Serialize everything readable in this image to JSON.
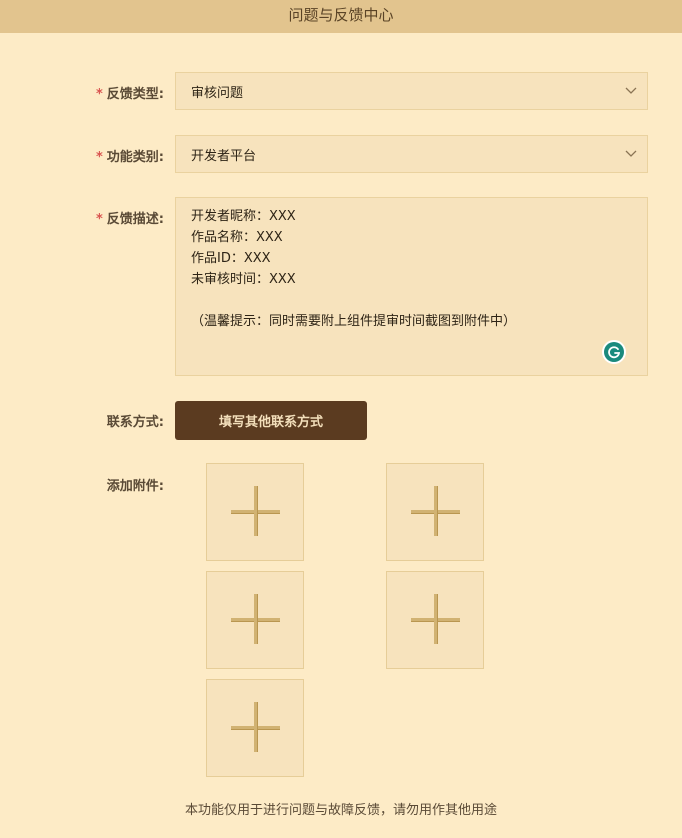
{
  "header": {
    "title": "问题与反馈中心"
  },
  "form": {
    "required_mark": "*",
    "feedback_type": {
      "label": "反馈类型:",
      "value": "审核问题"
    },
    "feature_category": {
      "label": "功能类别:",
      "value": "开发者平台"
    },
    "description": {
      "label": "反馈描述:",
      "lines": [
        "开发者昵称：XXX",
        "作品名称：XXX",
        "作品ID：XXX",
        "未审核时间：XXX",
        "",
        "（温馨提示：同时需要附上组件提审时间截图到附件中）"
      ]
    },
    "contact": {
      "label": "联系方式:",
      "button_label": "填写其他联系方式"
    },
    "attachments": {
      "label": "添加附件:",
      "slot_count": 5
    }
  },
  "footer": {
    "note": "本功能仅用于进行问题与故障反馈，请勿用作其他用途"
  },
  "icons": {
    "dropdown": "chevron-down-icon",
    "grammar": "grammarly-icon",
    "add": "plus-icon"
  },
  "colors": {
    "background": "#fdebc6",
    "header": "#e2c48e",
    "field": "#f7e3bd",
    "button": "#5b3b20",
    "required": "#d9534f"
  }
}
